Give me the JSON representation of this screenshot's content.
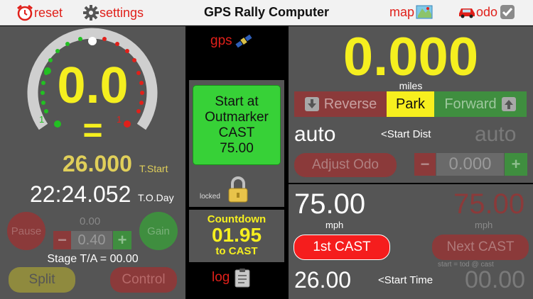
{
  "topbar": {
    "reset_label": "reset",
    "settings_label": "settings",
    "title": "GPS Rally Computer",
    "map_label": "map",
    "odo_label": "odo"
  },
  "left": {
    "speed_value": "0.0",
    "equal_sign": "=",
    "tick_left": "1",
    "tick_right": "1",
    "t_start_value": "26.000",
    "t_start_label": "T.Start",
    "tod_value": "22:24.052",
    "tod_label": "T.O.Day",
    "pause_label": "Pause",
    "gain_label": "Gain",
    "adjust_top": "0.00",
    "adjust_value": "0.40",
    "minus": "−",
    "plus": "+",
    "stage_ta": "Stage T/A = 00.00",
    "split_label": "Split",
    "control_label": "Control"
  },
  "middle": {
    "gps_label": "gps",
    "start_line1": "Start at",
    "start_line2": "Outmarker",
    "start_line3": "CAST",
    "start_line4": "75.00",
    "locked_label": "locked",
    "countdown_label": "Countdown",
    "countdown_value": "01.95",
    "countdown_to": "to CAST",
    "log_label": "log"
  },
  "right_top": {
    "distance": "0.000",
    "distance_unit": "miles",
    "reverse_label": "Reverse",
    "park_label": "Park",
    "forward_label": "Forward",
    "auto_left": "auto",
    "start_dist_label": "<Start Dist",
    "auto_right": "auto",
    "adjust_odo_label": "Adjust Odo",
    "odo_minus": "−",
    "odo_value": "0.000",
    "odo_plus": "+"
  },
  "right_bot": {
    "cast_value": "75.00",
    "cast_unit": "mph",
    "next_value": "75.00",
    "next_unit": "mph",
    "first_cast_label": "1st CAST",
    "next_cast_label": "Next CAST",
    "formula": "start = tod @ cast",
    "start_time_value": "26.00",
    "start_time_label": "<Start Time",
    "start_time_right": "00.00"
  },
  "colors": {
    "accent_yellow": "#f5ef1f",
    "accent_red": "#e0201a",
    "park_yellow": "#f7ef1e",
    "panel_gray": "#555555"
  },
  "icons": [
    "alarm-clock-icon",
    "gear-icon",
    "map-icon",
    "car-icon",
    "checkbox-icon",
    "satellite-icon",
    "padlock-icon",
    "clipboard-icon",
    "down-arrow-icon",
    "up-arrow-icon"
  ]
}
